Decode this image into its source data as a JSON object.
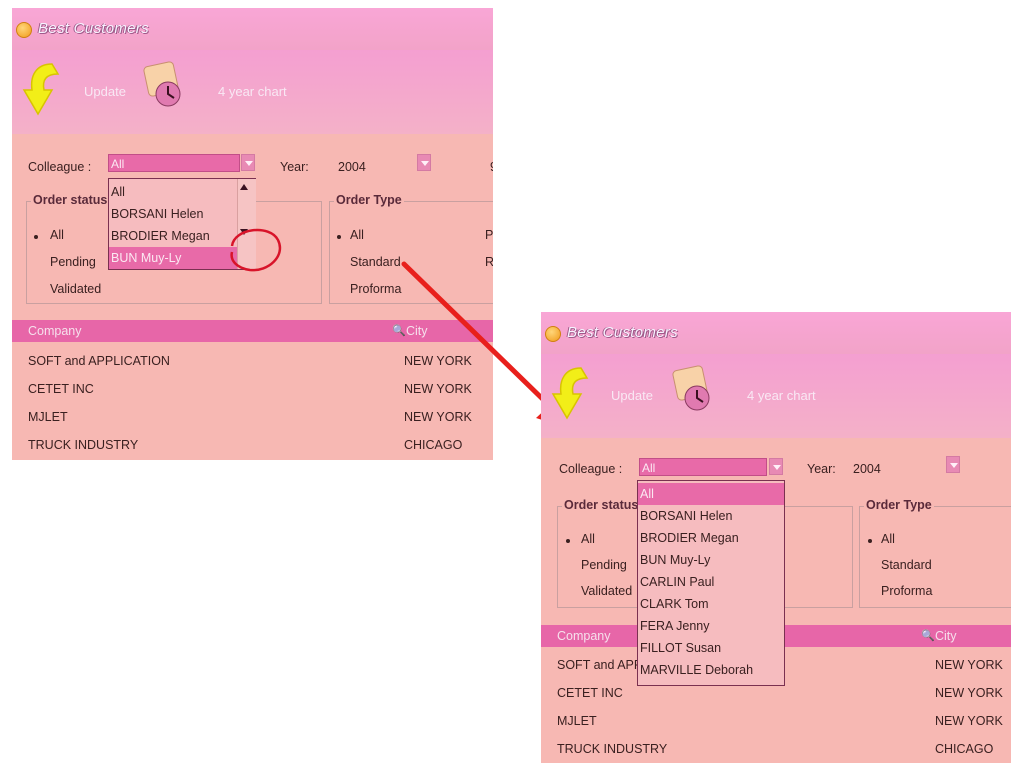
{
  "window_title": "Best Customers",
  "toolbar": {
    "update_label": "Update",
    "chart_label": "4 year chart"
  },
  "colleague": {
    "label": "Colleague :",
    "value": "All"
  },
  "year": {
    "label": "Year:",
    "value": "2004"
  },
  "order_status": {
    "title": "Order status to",
    "options": [
      "All",
      "Pending",
      "Validated"
    ],
    "selected": "All"
  },
  "order_type": {
    "title": "Order Type",
    "options": [
      "All",
      "Standard",
      "Proforma"
    ],
    "selected": "All"
  },
  "grid": {
    "headers": {
      "company": "Company",
      "city": "City"
    },
    "rows": [
      {
        "company": "SOFT and APPLICATION",
        "city": "NEW YORK"
      },
      {
        "company": "CETET INC",
        "city": "NEW YORK"
      },
      {
        "company": "MJLET",
        "city": "NEW YORK"
      },
      {
        "company": "TRUCK INDUSTRY",
        "city": "CHICAGO"
      }
    ]
  },
  "dropdown_before": {
    "items": [
      "All",
      "BORSANI Helen",
      "BRODIER Megan",
      "BUN Muy-Ly"
    ],
    "highlighted": "BUN Muy-Ly"
  },
  "dropdown_after": {
    "items": [
      "All",
      "BORSANI Helen",
      "BRODIER Megan",
      "BUN Muy-Ly",
      "CARLIN Paul",
      "CLARK Tom",
      "FERA Jenny",
      "FILLOT Susan",
      "MARVILLE Deborah"
    ],
    "highlighted": "All"
  },
  "colors": {
    "window_bg": "#f7b8b3",
    "accent": "#e86aa8",
    "arrow": "#e8201c",
    "circle": "#d8142a"
  },
  "partial_text": {
    "right_edge_year_suffix": "9",
    "right_edge_type_col_p": "P",
    "right_edge_type_col_r": "R",
    "applic_trunc": "SOFT and APPLI"
  }
}
